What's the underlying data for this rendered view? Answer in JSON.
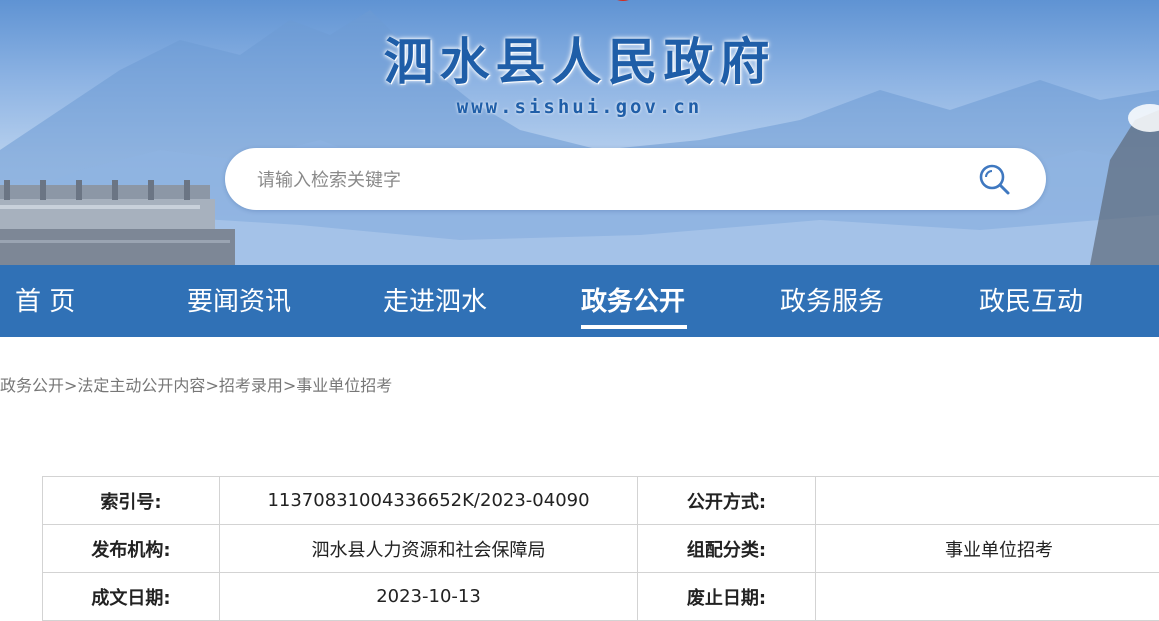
{
  "header": {
    "title": "泗水县人民政府",
    "url": "www.sishui.gov.cn",
    "search_placeholder": "请输入检索关键字",
    "colors": {
      "title": "#1f5ea8",
      "nav_bg": "#3071b6"
    }
  },
  "nav": {
    "items": [
      {
        "label": "首 页"
      },
      {
        "label": "要闻资讯"
      },
      {
        "label": "走进泗水"
      },
      {
        "label": "政务公开",
        "active": true
      },
      {
        "label": "政务服务"
      },
      {
        "label": "政民互动"
      }
    ]
  },
  "breadcrumb": {
    "items": [
      "政务公开",
      "法定主动公开内容",
      "招考录用",
      "事业单位招考"
    ],
    "separator": ">"
  },
  "meta_table": {
    "rows": [
      {
        "label1": "索引号:",
        "value1": "11370831004336652K/2023-04090",
        "label2": "公开方式:",
        "value2": ""
      },
      {
        "label1": "发布机构:",
        "value1": "泗水县人力资源和社会保障局",
        "label2": "组配分类:",
        "value2": "事业单位招考"
      },
      {
        "label1": "成文日期:",
        "value1": "2023-10-13",
        "label2": "废止日期:",
        "value2": ""
      }
    ]
  }
}
